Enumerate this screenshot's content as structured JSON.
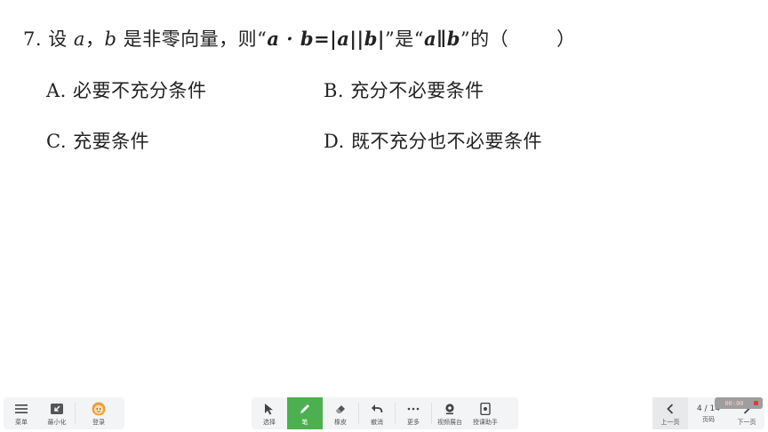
{
  "question": {
    "number": "7.",
    "stem_part1": "设",
    "var_a": "a",
    "comma": "，",
    "var_b": "b",
    "stem_part2": "是非零向量，则“",
    "math1": "a · b=|a||b|",
    "stem_part3": "”是“",
    "math2": "a∥b",
    "stem_part4": "”的（",
    "paren_close": "）"
  },
  "options": {
    "a": "A. 必要不充分条件",
    "b": "B. 充分不必要条件",
    "c": "C. 充要条件",
    "d": "D. 既不充分也不必要条件"
  },
  "toolbar_left": {
    "menu": "菜单",
    "minimize": "最小化",
    "login": "登录"
  },
  "toolbar_mid": {
    "select": "选择",
    "pen": "笔",
    "eraser": "橡皮",
    "undo": "撤消",
    "more": "更多",
    "video_booth": "视频展台",
    "teaching_assistant": "授课助手"
  },
  "toolbar_right": {
    "prev": "上一页",
    "page": "4 / 14",
    "page_label": "页码",
    "next": "下一页"
  },
  "timer": "00:00",
  "colors": {
    "pen_active": "#4caf50",
    "toolbar_bg": "#f3f4f6",
    "record": "#e53935"
  }
}
